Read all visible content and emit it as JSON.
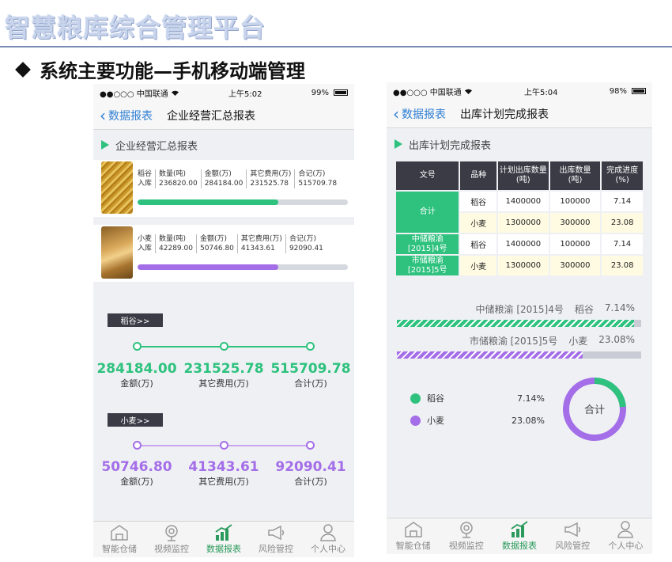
{
  "slide": {
    "title": "智慧粮库综合管理平台",
    "heading": "系统主要功能—手机移动端管理"
  },
  "phone1": {
    "status": {
      "carrier": "●●○○○ 中国联通",
      "time": "上午5:02",
      "battery": "99%"
    },
    "nav": {
      "back_label": "数据报表",
      "title": "企业经营汇总报表"
    },
    "section_label": "企业经营汇总报表",
    "grains": [
      {
        "name": "稻谷",
        "type": "入库",
        "columns": [
          {
            "label": "数量(吨)",
            "value": "236820.00"
          },
          {
            "label": "金额(万)",
            "value": "284184.00"
          },
          {
            "label": "其它费用(万)",
            "value": "231525.78"
          },
          {
            "label": "合记(万)",
            "value": "515709.78"
          }
        ],
        "progress": 0.67
      },
      {
        "name": "小麦",
        "type": "入库",
        "columns": [
          {
            "label": "数量(吨)",
            "value": "42289.00"
          },
          {
            "label": "金额(万)",
            "value": "50746.80"
          },
          {
            "label": "其它费用(万)",
            "value": "41343.61"
          },
          {
            "label": "合记(万)",
            "value": "92090.41"
          }
        ],
        "progress": 0.67
      }
    ],
    "summaries": [
      {
        "tag": "稻谷>>",
        "items": [
          {
            "value": "284184.00",
            "label": "金额(万)"
          },
          {
            "value": "231525.78",
            "label": "其它费用(万)"
          },
          {
            "value": "515709.78",
            "label": "合计(万)"
          }
        ]
      },
      {
        "tag": "小麦>>",
        "items": [
          {
            "value": "50746.80",
            "label": "金额(万)"
          },
          {
            "value": "41343.61",
            "label": "其它费用(万)"
          },
          {
            "value": "92090.41",
            "label": "合计(万)"
          }
        ]
      }
    ],
    "tabs": [
      "智能仓储",
      "视频监控",
      "数据报表",
      "风险管控",
      "个人中心"
    ]
  },
  "phone2": {
    "status": {
      "carrier": "●●○○○ 中国联通",
      "time": "上午5:04",
      "battery": "98%"
    },
    "nav": {
      "back_label": "数据报表",
      "title": "出库计划完成报表"
    },
    "section_label": "出库计划完成报表",
    "table": {
      "headers": [
        "文号",
        "品种",
        "计划出库数量\n(吨)",
        "出库数量\n(吨)",
        "完成进度\n(%)"
      ],
      "total_label": "合计",
      "total_rows": [
        {
          "variety": "稻谷",
          "plan": "1400000",
          "actual": "100000",
          "progress": "7.14"
        },
        {
          "variety": "小麦",
          "plan": "1300000",
          "actual": "300000",
          "progress": "23.08"
        }
      ],
      "rows": [
        {
          "doc": "中储粮渝\n[2015]4号",
          "variety": "稻谷",
          "plan": "1400000",
          "actual": "100000",
          "progress": "7.14"
        },
        {
          "doc": "市储粮渝\n[2015]5号",
          "variety": "小麦",
          "plan": "1300000",
          "actual": "300000",
          "progress": "23.08"
        }
      ]
    },
    "bars": [
      {
        "doc": "中储粮渝 [2015]4号",
        "variety": "稻谷",
        "percent_label": "7.14%",
        "fill": 0.97
      },
      {
        "doc": "市储粮渝 [2015]5号",
        "variety": "小麦",
        "percent_label": "23.08%",
        "fill": 0.76
      }
    ],
    "legend": [
      {
        "name": "稻谷",
        "value": "7.14%",
        "color": "#2ec27e"
      },
      {
        "name": "小麦",
        "value": "23.08%",
        "color": "#a46ee8"
      }
    ],
    "donut": {
      "center_label": "合计",
      "green_fraction": 0.2364,
      "purple_fraction": 0.7636
    },
    "tabs": [
      "智能仓储",
      "视频监控",
      "数据报表",
      "风险管控",
      "个人中心"
    ]
  },
  "colors": {
    "accent_green": "#2ec27e",
    "accent_purple": "#a46ee8",
    "ios_blue": "#2f7fd3",
    "dark_tag": "#3b3b46"
  }
}
